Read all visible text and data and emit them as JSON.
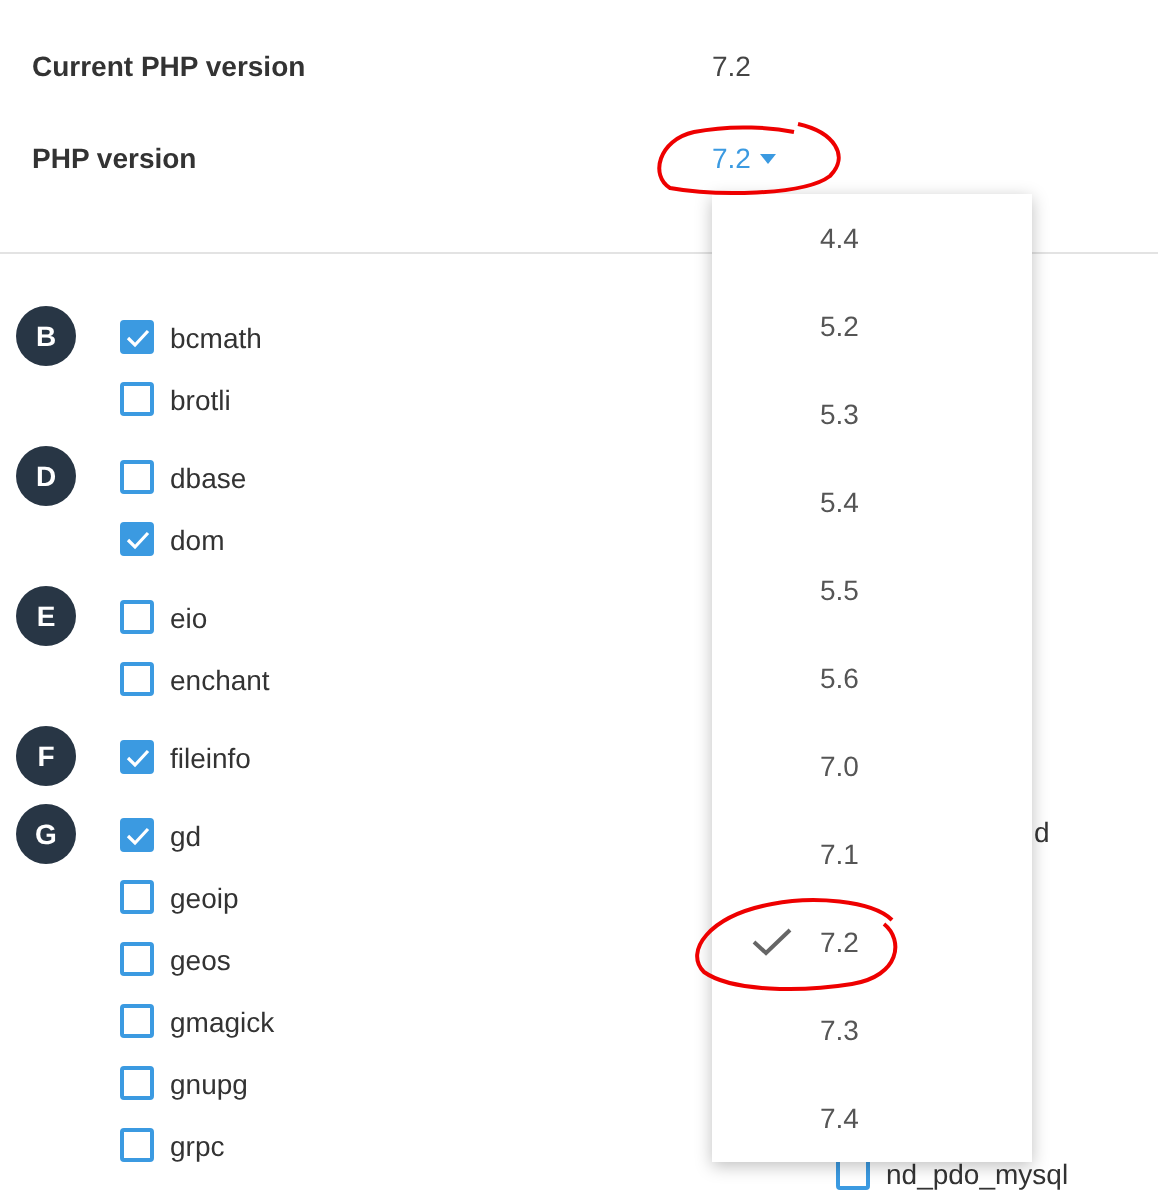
{
  "settings": [
    {
      "label": "Current PHP version",
      "value": "7.2",
      "kind": "text"
    },
    {
      "label": "PHP version",
      "value": "7.2",
      "kind": "dropdown"
    }
  ],
  "extension_groups": [
    {
      "letter": "B",
      "items": [
        {
          "name": "bcmath",
          "checked": true
        },
        {
          "name": "brotli",
          "checked": false
        }
      ]
    },
    {
      "letter": "D",
      "items": [
        {
          "name": "dbase",
          "checked": false
        },
        {
          "name": "dom",
          "checked": true
        }
      ]
    },
    {
      "letter": "E",
      "items": [
        {
          "name": "eio",
          "checked": false
        },
        {
          "name": "enchant",
          "checked": false
        }
      ]
    },
    {
      "letter": "F",
      "items": [
        {
          "name": "fileinfo",
          "checked": true
        }
      ]
    },
    {
      "letter": "G",
      "items": [
        {
          "name": "gd",
          "checked": true
        },
        {
          "name": "geoip",
          "checked": false
        },
        {
          "name": "geos",
          "checked": false
        },
        {
          "name": "gmagick",
          "checked": false
        },
        {
          "name": "gnupg",
          "checked": false
        },
        {
          "name": "grpc",
          "checked": false
        }
      ]
    }
  ],
  "second_column": [
    {
      "name": "d",
      "kind": "covered"
    },
    {
      "name": "nd_pdo_mysql",
      "checked": false,
      "kind": "full"
    }
  ],
  "version_menu": [
    {
      "label": "4.4",
      "selected": false
    },
    {
      "label": "5.2",
      "selected": false
    },
    {
      "label": "5.3",
      "selected": false
    },
    {
      "label": "5.4",
      "selected": false
    },
    {
      "label": "5.5",
      "selected": false
    },
    {
      "label": "5.6",
      "selected": false
    },
    {
      "label": "7.0",
      "selected": false
    },
    {
      "label": "7.1",
      "selected": false
    },
    {
      "label": "7.2",
      "selected": true
    },
    {
      "label": "7.3",
      "selected": false
    },
    {
      "label": "7.4",
      "selected": false
    }
  ]
}
